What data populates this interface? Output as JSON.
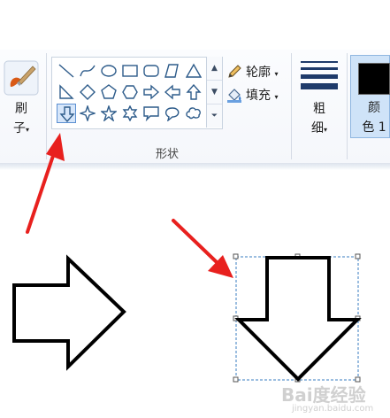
{
  "ribbon": {
    "brushes": {
      "label_top": "刷",
      "label_bottom": "子",
      "icon": "brush-icon"
    },
    "shapes_group_label": "形状",
    "outline_label": "轮廓",
    "fill_label": "填充",
    "size": {
      "label_top": "粗",
      "label_bottom": "细"
    },
    "color1": {
      "label_top": "颜",
      "label_bottom": "色 1",
      "value": "#000000"
    },
    "shapes": [
      "line",
      "curve",
      "oval",
      "rectangle",
      "rounded-rectangle",
      "polygon",
      "triangle",
      "right-triangle",
      "diamond",
      "pentagon",
      "hexagon",
      "right-arrow",
      "left-arrow",
      "up-arrow",
      "down-arrow",
      "four-point-star",
      "five-point-star",
      "six-point-star",
      "rectangular-callout",
      "oval-callout",
      "cloud-callout"
    ],
    "selected_shape": "down-arrow"
  },
  "annotations": {
    "arrow_color": "#e8201e"
  },
  "watermark": {
    "main": "Bai度经验",
    "sub": "jingyan.baidu.com"
  }
}
